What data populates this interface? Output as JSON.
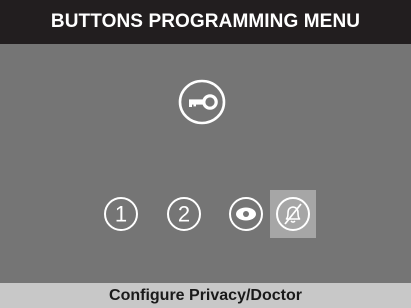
{
  "header": {
    "title": "BUTTONS PROGRAMMING MENU"
  },
  "icons": {
    "key": "key-icon",
    "options": [
      {
        "icon": "circled-digit-one-icon",
        "label": "1",
        "selected": false
      },
      {
        "icon": "circled-digit-two-icon",
        "label": "2",
        "selected": false
      },
      {
        "icon": "eye-icon",
        "selected": false
      },
      {
        "icon": "bell-off-icon",
        "selected": true
      }
    ]
  },
  "footer": {
    "status": "Configure Privacy/Doctor"
  },
  "colors": {
    "screen_bg": "#757575",
    "title_bg": "#221e1f",
    "footer_bg": "#c8c8c8",
    "selected_bg": "#a6a6a6",
    "icon_fg": "#ffffff"
  }
}
